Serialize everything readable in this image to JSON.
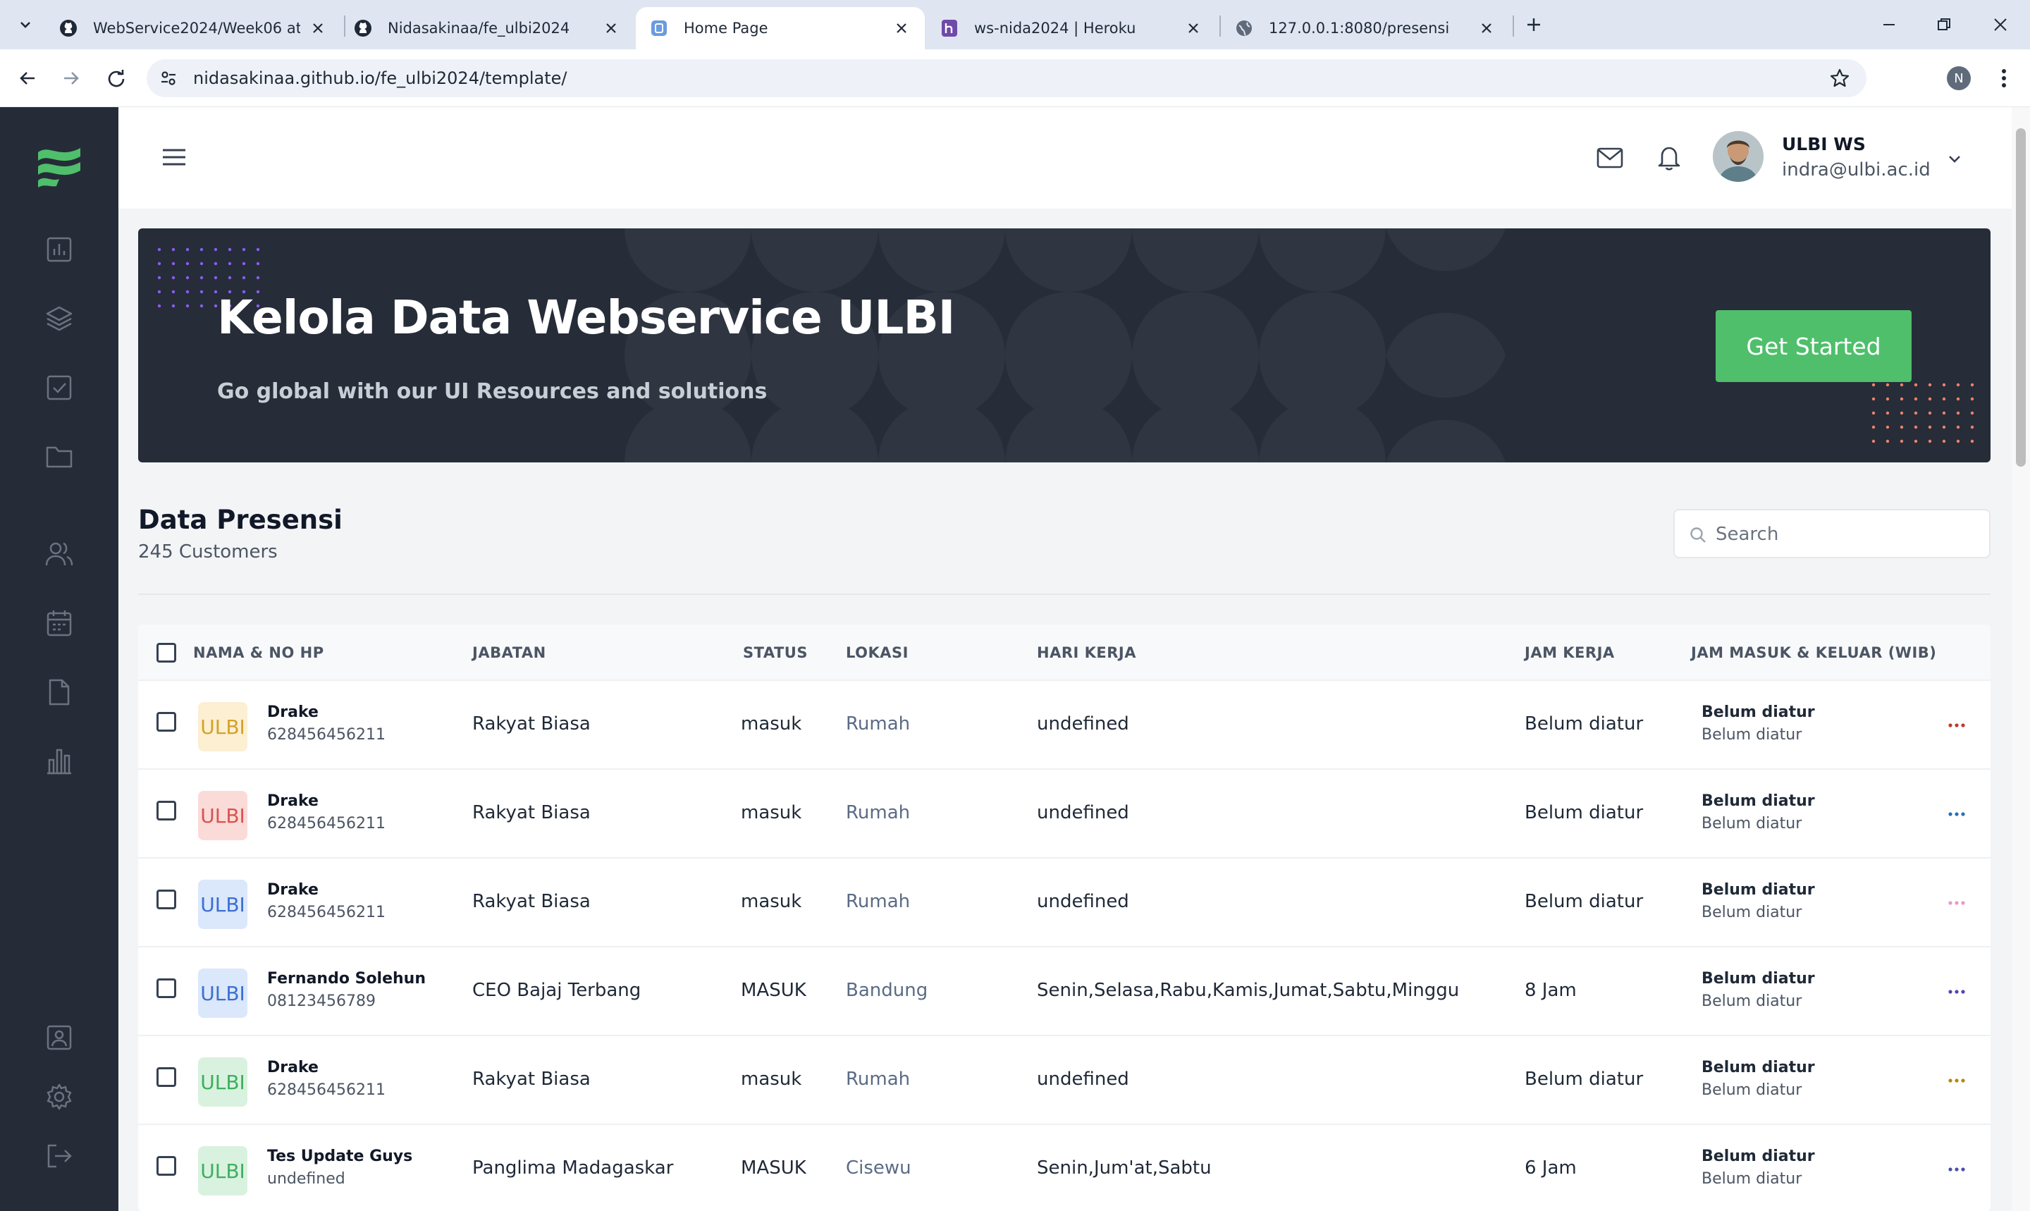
{
  "browser": {
    "tabs": [
      {
        "title": "WebService2024/Week06 at ma",
        "icon": "github-icon",
        "active": false
      },
      {
        "title": "Nidasakinaa/fe_ulbi2024",
        "icon": "github-icon",
        "active": false
      },
      {
        "title": "Home Page",
        "icon": "page-icon",
        "active": true
      },
      {
        "title": "ws-nida2024 | Heroku",
        "icon": "heroku-icon",
        "active": false
      },
      {
        "title": "127.0.0.1:8080/presensi",
        "icon": "globe-icon",
        "active": false
      }
    ],
    "url": "nidasakinaa.github.io/fe_ulbi2024/template/",
    "profile_initial": "N"
  },
  "header": {
    "user_name": "ULBI WS",
    "user_email": "indra@ulbi.ac.id"
  },
  "banner": {
    "title": "Kelola Data Webservice ULBI",
    "subtitle": "Go global with our UI Resources and solutions",
    "cta_label": "Get Started"
  },
  "section": {
    "title": "Data Presensi",
    "subtitle": "245 Customers",
    "search_placeholder": "Search"
  },
  "table": {
    "headers": {
      "name": "NAMA & NO HP",
      "jabatan": "JABATAN",
      "status": "STATUS",
      "lokasi": "LOKASI",
      "hari_kerja": "HARI KERJA",
      "jam_kerja": "JAM KERJA",
      "jam_masuk_keluar": "JAM MASUK & KELUAR (WIB)"
    },
    "rows": [
      {
        "badge": "ULBI",
        "badge_bg": "#fcefd2",
        "badge_fg": "#d4a12a",
        "name": "Drake",
        "phone": "628456456211",
        "jabatan": "Rakyat Biasa",
        "status": "masuk",
        "lokasi": "Rumah",
        "hari_kerja": "undefined",
        "jam_kerja": "Belum diatur",
        "jam_masuk": "Belum diatur",
        "jam_keluar": "Belum diatur",
        "more_color": "#c0392b"
      },
      {
        "badge": "ULBI",
        "badge_bg": "#fadbd8",
        "badge_fg": "#d9534f",
        "name": "Drake",
        "phone": "628456456211",
        "jabatan": "Rakyat Biasa",
        "status": "masuk",
        "lokasi": "Rumah",
        "hari_kerja": "undefined",
        "jam_kerja": "Belum diatur",
        "jam_masuk": "Belum diatur",
        "jam_keluar": "Belum diatur",
        "more_color": "#2a6fb5"
      },
      {
        "badge": "ULBI",
        "badge_bg": "#dbe7fb",
        "badge_fg": "#3b6fd1",
        "name": "Drake",
        "phone": "628456456211",
        "jabatan": "Rakyat Biasa",
        "status": "masuk",
        "lokasi": "Rumah",
        "hari_kerja": "undefined",
        "jam_kerja": "Belum diatur",
        "jam_masuk": "Belum diatur",
        "jam_keluar": "Belum diatur",
        "more_color": "#e89ac7"
      },
      {
        "badge": "ULBI",
        "badge_bg": "#dbe7fb",
        "badge_fg": "#3b6fd1",
        "name": "Fernando Solehun",
        "phone": "08123456789",
        "jabatan": "CEO Bajaj Terbang",
        "status": "MASUK",
        "lokasi": "Bandung",
        "hari_kerja": "Senin,Selasa,Rabu,Kamis,Jumat,Sabtu,Minggu",
        "jam_kerja": "8 Jam",
        "jam_masuk": "Belum diatur",
        "jam_keluar": "Belum diatur",
        "more_color": "#5b3fb5"
      },
      {
        "badge": "ULBI",
        "badge_bg": "#d9f2df",
        "badge_fg": "#3fae5f",
        "name": "Drake",
        "phone": "628456456211",
        "jabatan": "Rakyat Biasa",
        "status": "masuk",
        "lokasi": "Rumah",
        "hari_kerja": "undefined",
        "jam_kerja": "Belum diatur",
        "jam_masuk": "Belum diatur",
        "jam_keluar": "Belum diatur",
        "more_color": "#b8860b"
      },
      {
        "badge": "ULBI",
        "badge_bg": "#d9f2df",
        "badge_fg": "#3fae5f",
        "name": "Tes Update Guys",
        "phone": "undefined",
        "jabatan": "Panglima Madagaskar",
        "status": "MASUK",
        "lokasi": "Cisewu",
        "hari_kerja": "Senin,Jum'at,Sabtu",
        "jam_kerja": "6 Jam",
        "jam_masuk": "Belum diatur",
        "jam_keluar": "Belum diatur",
        "more_color": "#4b4fa5"
      }
    ]
  },
  "colors": {
    "sidebar_bg": "#252c37",
    "banner_bg": "#262c38",
    "accent_green": "#4fbf6b"
  }
}
